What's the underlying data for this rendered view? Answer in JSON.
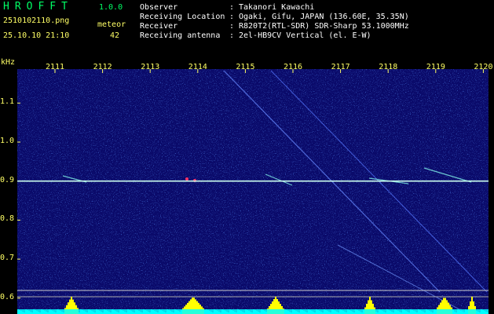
{
  "app": {
    "title": "HROFFT",
    "version": "1.0.0"
  },
  "file": {
    "name": "2510102110.png",
    "datetime": "25.10.10 21:10"
  },
  "detection": {
    "label": "meteor",
    "count": "42"
  },
  "info": [
    {
      "key": "Observer",
      "value": "Takanori Kawachi"
    },
    {
      "key": "Receiving Location",
      "value": "Ogaki, Gifu, JAPAN (136.60E, 35.35N)"
    },
    {
      "key": "Receiver",
      "value": "R820T2(RTL-SDR) SDR-Sharp 53.1000MHz"
    },
    {
      "key": "Receiving antenna",
      "value": "2el-HB9CV Vertical (el. E-W)"
    }
  ],
  "chart_data": {
    "type": "heatmap",
    "ylabel": "kHz",
    "x_ticks": [
      "2111",
      "2112",
      "2113",
      "2114",
      "2115",
      "2116",
      "2117",
      "2118",
      "2119",
      "2120"
    ],
    "y_ticks": [
      "1.1",
      "1.0",
      "0.9",
      "0.8",
      "0.7",
      "0.6"
    ],
    "carrier_khz": 0.9,
    "colors": {
      "background": "#0a0a6a",
      "carrier": "#ccffee",
      "label": "#ffff66",
      "power": "#ffff00",
      "floor": "#00ffff"
    }
  }
}
